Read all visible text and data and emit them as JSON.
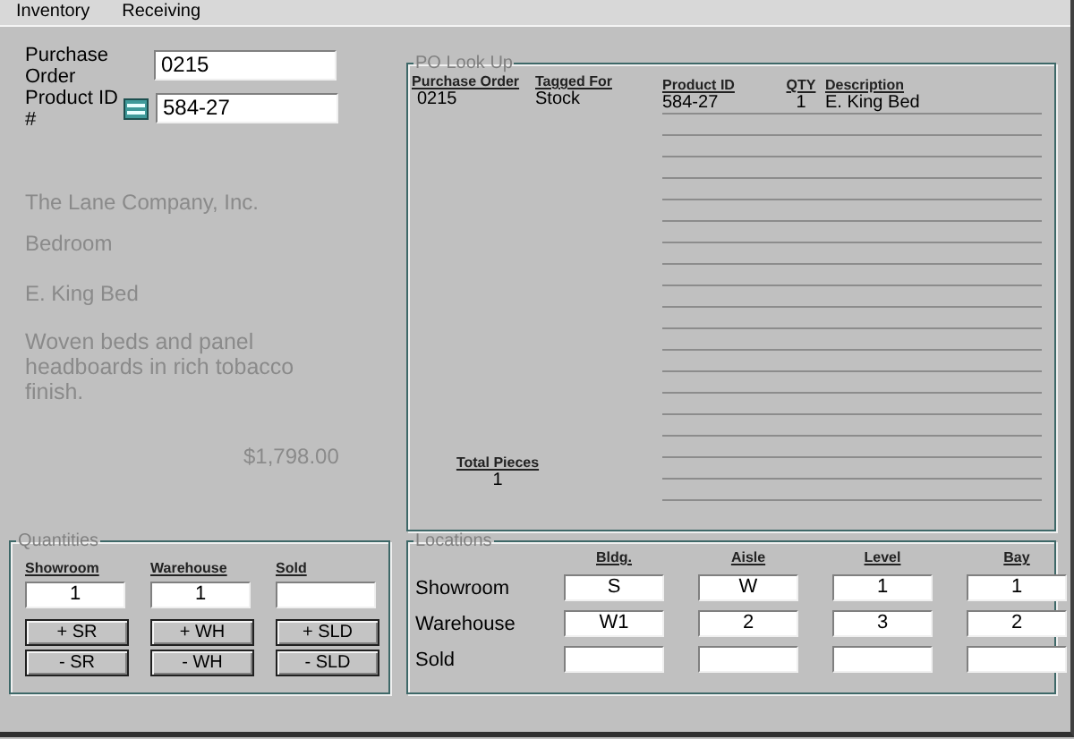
{
  "menu": [
    {
      "label": "Inventory"
    },
    {
      "label": "Receiving"
    }
  ],
  "lookup_form": {
    "fields": [
      {
        "kind": "plain",
        "label": "Purchase Order",
        "value": "0215"
      },
      {
        "kind": "lookup",
        "label": "Product ID #",
        "value": "584-27"
      }
    ]
  },
  "product": {
    "vendor": "The Lane Company, Inc.",
    "category": "Bedroom",
    "name": "E. King Bed",
    "description": "Woven beds and panel headboards in rich tobacco finish.",
    "price": "$1,798.00"
  },
  "po_lookup": {
    "title": "PO Look Up",
    "columns": [
      "Purchase Order",
      "Tagged For",
      "Product ID",
      "QTY",
      "Description"
    ],
    "purchase_order": "0215",
    "tagged_for": "Stock",
    "lines": [
      {
        "product_id": "584-27",
        "qty": "1",
        "description": "E. King Bed"
      }
    ],
    "total_pieces_label": "Total Pieces",
    "total_pieces": "1"
  },
  "quantities": {
    "title": "Quantities",
    "columns": [
      {
        "label": "Showroom",
        "value": "1",
        "add": "+ SR",
        "remove": "- SR"
      },
      {
        "label": "Warehouse",
        "value": "1",
        "add": "+ WH",
        "remove": "- WH"
      },
      {
        "label": "Sold",
        "add": "+ SLD",
        "remove": "- SLD"
      }
    ]
  },
  "locations": {
    "title": "Locations",
    "columns": [
      "Bldg.",
      "Aisle",
      "Level",
      "Bay"
    ],
    "rows": [
      {
        "label": "Showroom",
        "values": [
          "S",
          "W",
          "1",
          "1"
        ]
      },
      {
        "label": "Warehouse",
        "values": [
          "W1",
          "2",
          "3",
          "2"
        ]
      },
      {
        "label": "Sold",
        "values": []
      }
    ]
  }
}
